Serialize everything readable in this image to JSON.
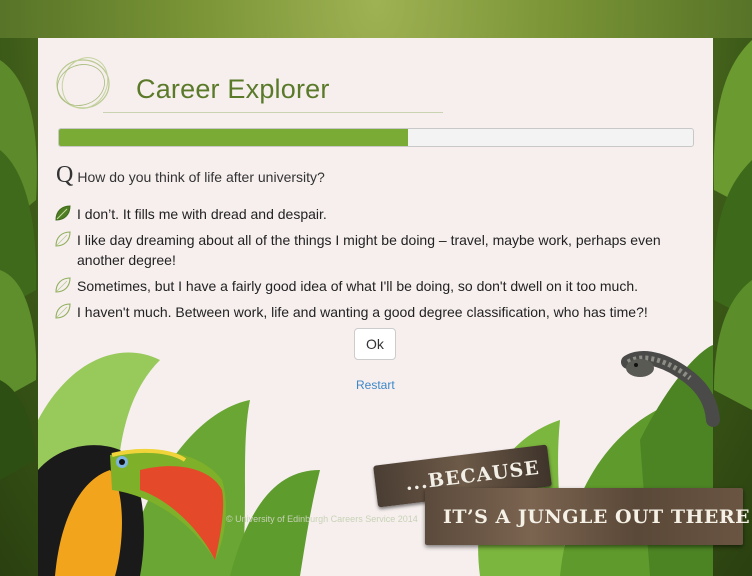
{
  "app": {
    "title": "Career Explorer"
  },
  "progress": {
    "fraction": 0.55
  },
  "question": {
    "marker": "Q",
    "text": "How do you think of life after university?"
  },
  "options": [
    {
      "label": "I don’t. It fills me with dread and despair.",
      "selected": true
    },
    {
      "label": "I like day dreaming about all of the things I might be doing – travel, maybe work, perhaps even another degree!",
      "selected": false
    },
    {
      "label": "Sometimes, but I have a fairly good idea of what I'll be doing, so don't dwell on it too much.",
      "selected": false
    },
    {
      "label": "I haven't much. Between work, life and wanting a good degree classification, who has time?!",
      "selected": false
    }
  ],
  "actions": {
    "ok_label": "Ok",
    "restart_label": "Restart"
  },
  "signs": {
    "line1": "...BECAUSE",
    "line2": "IT’S A JUNGLE OUT THERE"
  },
  "footer": {
    "text": "© University of Edinburgh Careers Service 2014"
  },
  "colors": {
    "accent": "#7aab35",
    "title": "#5a7a2a",
    "link": "#3d87c8",
    "panel": "#f6efee"
  },
  "icons": {
    "option_selected": "leaf-filled-icon",
    "option_unselected": "leaf-outline-icon",
    "logo": "swirl-logo-icon"
  }
}
